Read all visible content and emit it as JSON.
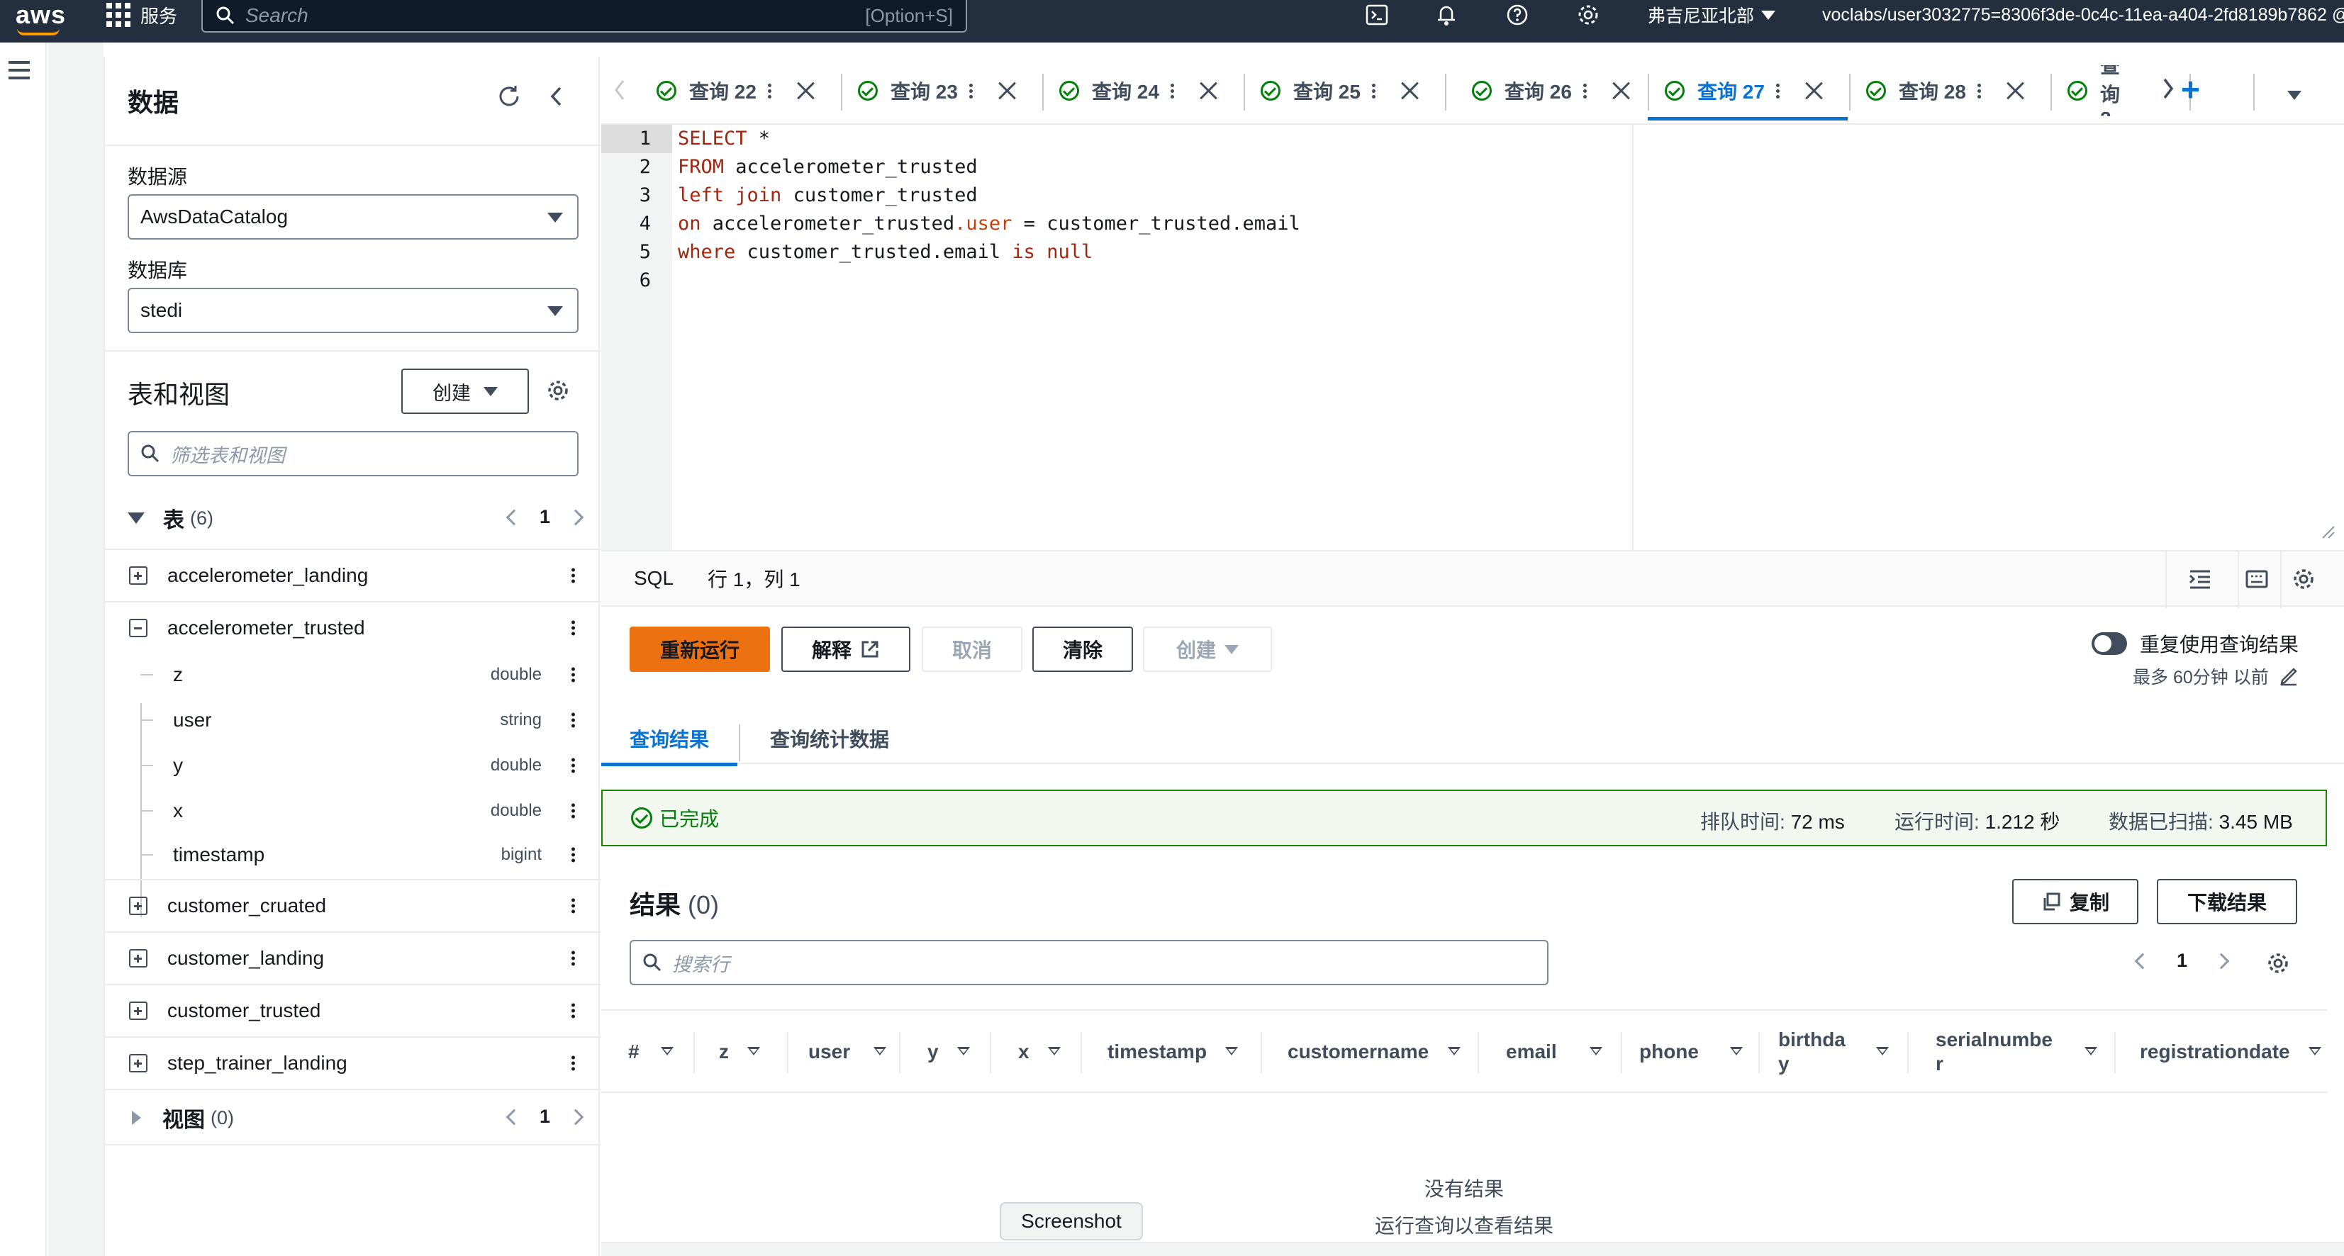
{
  "topnav": {
    "logo": "aws",
    "services_label": "服务",
    "search_placeholder": "Search",
    "search_shortcut": "[Option+S]",
    "region": "弗吉尼亚北部",
    "account": "voclabs/user3032775=8306f3de-0c4c-11ea-a404-2fd8189b7862 @"
  },
  "datapanel": {
    "title": "数据",
    "datasource_label": "数据源",
    "datasource_value": "AwsDataCatalog",
    "database_label": "数据库",
    "database_value": "stedi",
    "tables_views_title": "表和视图",
    "create_label": "创建",
    "filter_placeholder": "筛选表和视图",
    "tables_section": {
      "name": "表",
      "count": "(6)",
      "page": "1"
    },
    "tables": [
      {
        "name": "accelerometer_landing",
        "expanded": false
      },
      {
        "name": "accelerometer_trusted",
        "expanded": true
      },
      {
        "name": "customer_cruated",
        "expanded": false
      },
      {
        "name": "customer_landing",
        "expanded": false
      },
      {
        "name": "customer_trusted",
        "expanded": false
      },
      {
        "name": "step_trainer_landing",
        "expanded": false
      }
    ],
    "columns": [
      {
        "name": "z",
        "type": "double"
      },
      {
        "name": "user",
        "type": "string"
      },
      {
        "name": "y",
        "type": "double"
      },
      {
        "name": "x",
        "type": "double"
      },
      {
        "name": "timestamp",
        "type": "bigint"
      }
    ],
    "views_section": {
      "name": "视图",
      "count": "(0)",
      "page": "1"
    }
  },
  "tabs": [
    {
      "label": "查询 22",
      "active": false
    },
    {
      "label": "查询 23",
      "active": false
    },
    {
      "label": "查询 24",
      "active": false
    },
    {
      "label": "查询 25",
      "active": false
    },
    {
      "label": "查询 26",
      "active": false
    },
    {
      "label": "查询 27",
      "active": true
    },
    {
      "label": "查询 28",
      "active": false
    },
    {
      "label": "查询 2",
      "active": false
    }
  ],
  "editor": {
    "line_numbers": [
      "1",
      "2",
      "3",
      "4",
      "5",
      "6"
    ],
    "lines": [
      [
        "SELECT",
        " *"
      ],
      [
        "FROM",
        " accelerometer_trusted"
      ],
      [
        "left join",
        " customer_trusted"
      ],
      [
        "on",
        " accelerometer_trusted",
        ".user",
        " = customer_trusted.email"
      ],
      [
        "where",
        " customer_trusted.email ",
        "is null"
      ],
      [
        ""
      ]
    ]
  },
  "statusbar": {
    "language": "SQL",
    "position": "行 1，列 1"
  },
  "actions": {
    "rerun": "重新运行",
    "explain": "解释",
    "cancel": "取消",
    "clear": "清除",
    "create": "创建",
    "reuse_label": "重复使用查询结果",
    "reuse_sub": "最多 60分钟 以前"
  },
  "result_tabs": {
    "results": "查询结果",
    "stats": "查询统计数据"
  },
  "status": {
    "state": "已完成",
    "queue_label": "排队时间:",
    "queue_value": "72 ms",
    "run_label": "运行时间:",
    "run_value": "1.212 秒",
    "scan_label": "数据已扫描:",
    "scan_value": "3.45 MB"
  },
  "results": {
    "title": "结果",
    "count": "(0)",
    "copy": "复制",
    "download": "下载结果",
    "search_placeholder": "搜索行",
    "page": "1",
    "columns": [
      "#",
      "z",
      "user",
      "y",
      "x",
      "timestamp",
      "customername",
      "email",
      "phone",
      "birthda\ny",
      "serialnumbe\nr",
      "registrationdate"
    ],
    "empty_title": "没有结果",
    "empty_sub": "运行查询以查看结果"
  },
  "tooltip": "Screenshot",
  "colors": {
    "nav_bg": "#232f3e",
    "primary": "#ec7211",
    "link": "#0972d3",
    "success": "#037f0c"
  }
}
